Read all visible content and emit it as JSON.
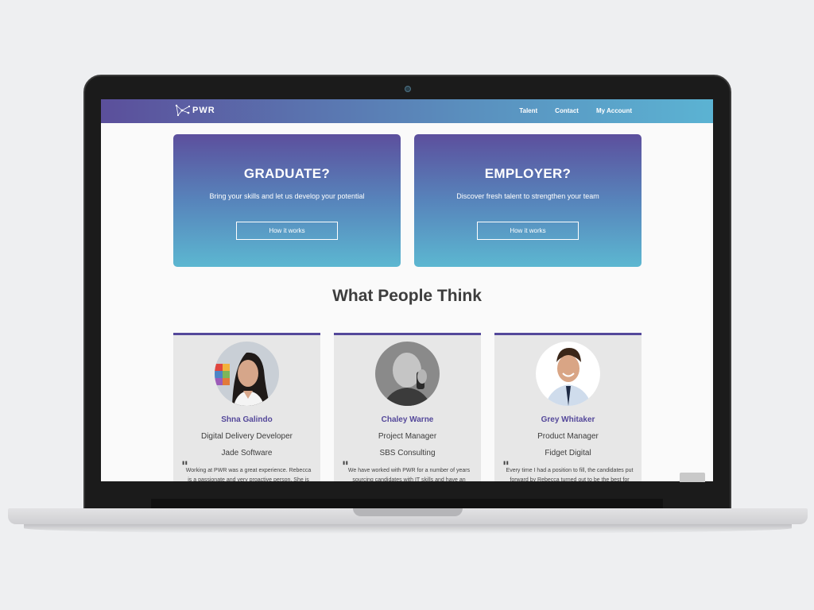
{
  "nav": {
    "logo_text": "PWR",
    "links": [
      "Talent",
      "Contact",
      "My Account"
    ]
  },
  "hero": [
    {
      "title": "GRADUATE?",
      "subtitle": "Bring your skills and let us develop your potential",
      "button": "How it works"
    },
    {
      "title": "EMPLOYER?",
      "subtitle": "Discover fresh talent to strengthen your team",
      "button": "How it works"
    }
  ],
  "section_title": "What People Think",
  "testimonials": [
    {
      "name": "Shna Galindo",
      "role": "Digital Delivery Developer",
      "company": "Jade Software",
      "quote_mark": "\"",
      "quote": "Working at PWR was a great experience. Rebecca is a passionate and very proactive person. She is"
    },
    {
      "name": "Chaley Warne",
      "role": "Project Manager",
      "company": "SBS Consulting",
      "quote_mark": "\"",
      "quote": "We have worked with PWR for a number of years sourcing candidates with IT skills and have an"
    },
    {
      "name": "Grey Whitaker",
      "role": "Product Manager",
      "company": "Fidget Digital",
      "quote_mark": "\"",
      "quote": "Every time I had a position to fill, the candidates put forward by Rebecca turned out to be the best for the"
    }
  ],
  "colors": {
    "brand_purple": "#54489a",
    "gradient_top": "#5c4f9d",
    "gradient_bottom": "#5cb7d1"
  }
}
